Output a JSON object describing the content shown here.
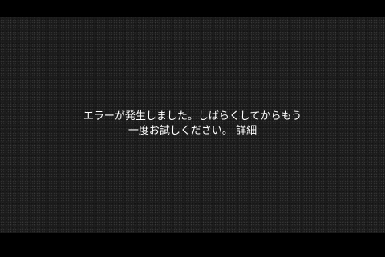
{
  "error": {
    "line1": "エラーが発生しました。しばらくしてからもう",
    "line2": "一度お試しください。",
    "details_link": "詳細"
  }
}
